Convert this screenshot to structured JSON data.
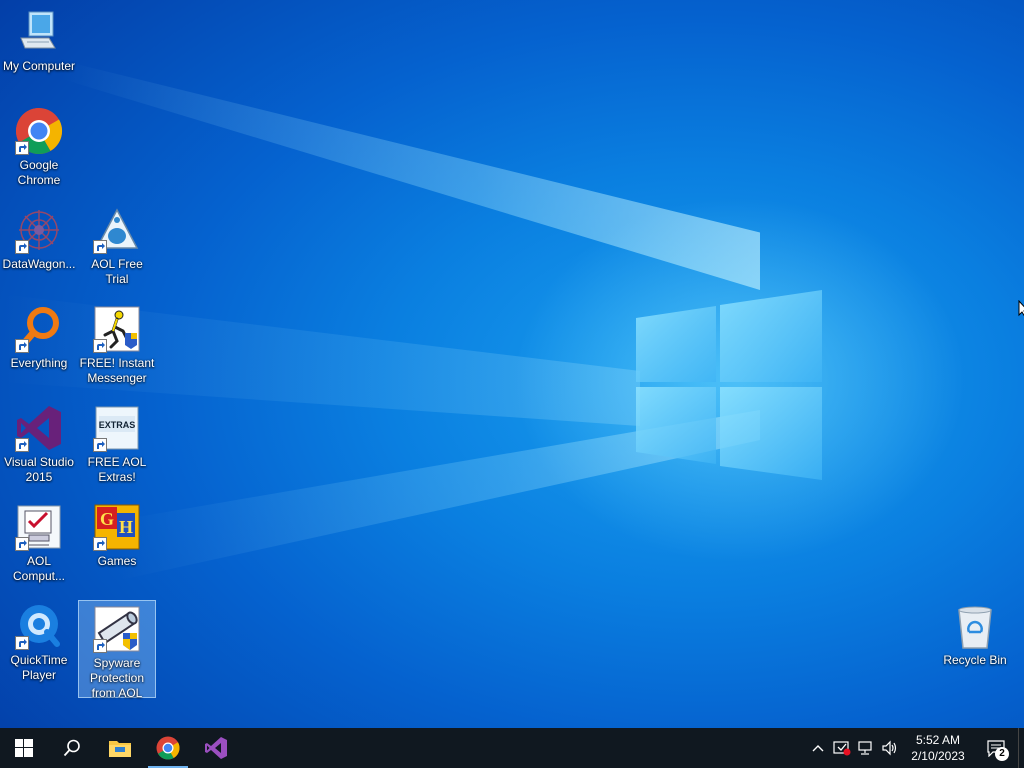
{
  "desktop": {
    "icons": {
      "my_computer": {
        "label": "My Computer",
        "icon": "computer-icon"
      },
      "chrome": {
        "label": "Google Chrome",
        "icon": "chrome-icon"
      },
      "datawagon": {
        "label": "DataWagon...",
        "icon": "datawagon-icon"
      },
      "aol_trial": {
        "label": "AOL Free Trial",
        "icon": "aol-triangle-icon"
      },
      "everything": {
        "label": "Everything",
        "icon": "magnifier-icon"
      },
      "aim": {
        "label": "FREE! Instant Messenger",
        "icon": "aim-running-man-icon"
      },
      "visual_studio": {
        "label": "Visual Studio 2015",
        "icon": "visual-studio-icon"
      },
      "aol_extras": {
        "label": "FREE AOL Extras!",
        "icon": "extras-icon",
        "badge_text": "EXTRAS"
      },
      "aol_computer": {
        "label": "AOL Comput...",
        "icon": "checklist-monitor-icon"
      },
      "games": {
        "label": "Games",
        "icon": "games-icon"
      },
      "quicktime": {
        "label": "QuickTime Player",
        "icon": "quicktime-icon"
      },
      "spyware": {
        "label": "Spyware Protection from AOL",
        "icon": "spyglass-shield-icon"
      },
      "recycle_bin": {
        "label": "Recycle Bin",
        "icon": "recycle-bin-icon"
      }
    },
    "selected_icon": "Spyware Protection from AOL"
  },
  "taskbar": {
    "pinned": [
      {
        "name": "File Explorer",
        "icon": "folder-icon"
      },
      {
        "name": "Google Chrome",
        "icon": "chrome-icon"
      },
      {
        "name": "Visual Studio",
        "icon": "visual-studio-icon"
      }
    ],
    "clock": {
      "time": "5:52 AM",
      "date": "2/10/2023"
    },
    "notifications_count": "2"
  },
  "colors": {
    "taskbar_bg": "#101820",
    "accent": "#6fb3f0",
    "desktop_blue": "#0a7fe0"
  }
}
